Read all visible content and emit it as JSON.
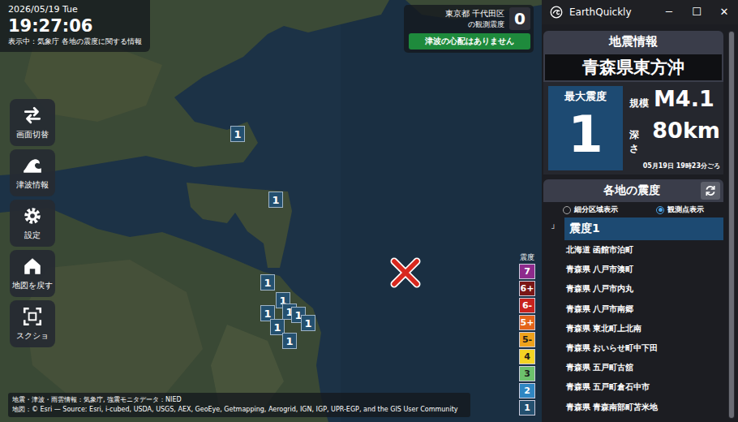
{
  "window": {
    "title": "EarthQuickly",
    "controls": [
      "─",
      "☐",
      "✕"
    ]
  },
  "clock": {
    "date": "2026/05/19 Tue",
    "time": "19:27:06",
    "caption": "表示中：気象庁 各地の震度に関する情報"
  },
  "observed": {
    "place": "東京都 千代田区",
    "caption": "の観測震度",
    "value": "0"
  },
  "tsunami_notice": "津波の心配はありません",
  "toolbar": [
    {
      "label": "画面切替",
      "kind": "switch"
    },
    {
      "label": "津波情報",
      "kind": "tsunami"
    },
    {
      "label": "設定",
      "kind": "settings"
    },
    {
      "label": "地図を戻す",
      "kind": "home"
    },
    {
      "label": "スクショ",
      "kind": "screenshot"
    }
  ],
  "map": {
    "markers": [
      {
        "label": "1"
      },
      {
        "label": "1"
      },
      {
        "label": "1"
      },
      {
        "label": "1"
      },
      {
        "label": "1"
      },
      {
        "label": "1"
      },
      {
        "label": "1"
      },
      {
        "label": "1"
      },
      {
        "label": "1"
      },
      {
        "label": "1"
      }
    ]
  },
  "legend": {
    "title": "震度",
    "levels": [
      {
        "label": "7",
        "color": "#8e2a8c"
      },
      {
        "label": "6+",
        "color": "#7a1616"
      },
      {
        "label": "6-",
        "color": "#c8231e"
      },
      {
        "label": "5+",
        "color": "#e4641a"
      },
      {
        "label": "5-",
        "color": "#eea21c"
      },
      {
        "label": "4",
        "color": "#f3d424"
      },
      {
        "label": "3",
        "color": "#6cc06c"
      },
      {
        "label": "2",
        "color": "#2f86c2"
      },
      {
        "label": "1",
        "color": "#24506f"
      }
    ]
  },
  "attribution": [
    "地震・津波・雨雲情報：気象庁, 強震モニタデータ：NIED",
    "地図：© Esri — Source: Esri, i-cubed, USDA, USGS, AEX, GeoEye, Getmapping, Aerogrid, IGN, IGP, UPR-EGP, and the GIS User Community"
  ],
  "quake": {
    "heading": "地震情報",
    "region": "青森県東方沖",
    "max_label": "最大震度",
    "max_value": "1",
    "magnitude_label": "規模",
    "magnitude": "M4.1",
    "depth_label": "深さ",
    "depth": "80km",
    "time": "05月19日 19時23分ごろ"
  },
  "intensity_list": {
    "heading": "各地の震度",
    "modes": [
      {
        "label": "細分区域表示",
        "selected": false
      },
      {
        "label": "観測点表示",
        "selected": true
      }
    ],
    "groups": [
      {
        "mark": "┘",
        "label": "震度1",
        "expanded": true,
        "selected": true,
        "stations": [
          "北海道 函館市泊町",
          "青森県 八戸市湊町",
          "青森県 八戸市内丸",
          "青森県 八戸市南郷",
          "青森県 東北町上北南",
          "青森県 おいらせ町中下田",
          "青森県 五戸町古舘",
          "青森県 五戸町倉石中市",
          "青森県 青森南部町苫米地"
        ]
      }
    ]
  }
}
